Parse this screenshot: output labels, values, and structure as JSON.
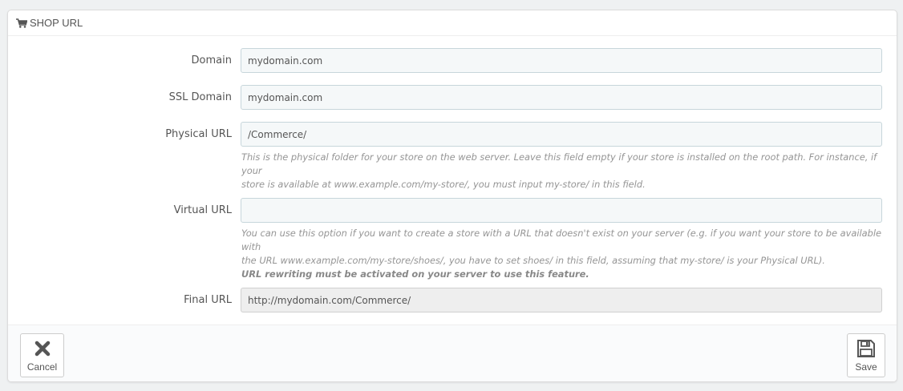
{
  "panel": {
    "title": "SHOP URL",
    "icon": "shopping-cart-icon"
  },
  "fields": {
    "domain": {
      "label": "Domain",
      "value": "mydomain.com"
    },
    "ssl_domain": {
      "label": "SSL Domain",
      "value": "mydomain.com"
    },
    "physical_url": {
      "label": "Physical URL",
      "value": "/Commerce/",
      "help_line1": "This is the physical folder for your store on the web server. Leave this field empty if your store is installed on the root path. For instance, if your",
      "help_line2": "store is available at www.example.com/my-store/, you must input my-store/ in this field."
    },
    "virtual_url": {
      "label": "Virtual URL",
      "value": "",
      "help_line1": "You can use this option if you want to create a store with a URL that doesn't exist on your server (e.g. if you want your store to be available with",
      "help_line2": "the URL www.example.com/my-store/shoes/, you have to set shoes/ in this field, assuming that my-store/ is your Physical URL).",
      "help_bold": "URL rewriting must be activated on your server to use this feature."
    },
    "final_url": {
      "label": "Final URL",
      "value": "http://mydomain.com/Commerce/"
    }
  },
  "footer": {
    "cancel_label": "Cancel",
    "cancel_icon": "close-icon",
    "save_label": "Save",
    "save_icon": "floppy-disk-icon"
  }
}
